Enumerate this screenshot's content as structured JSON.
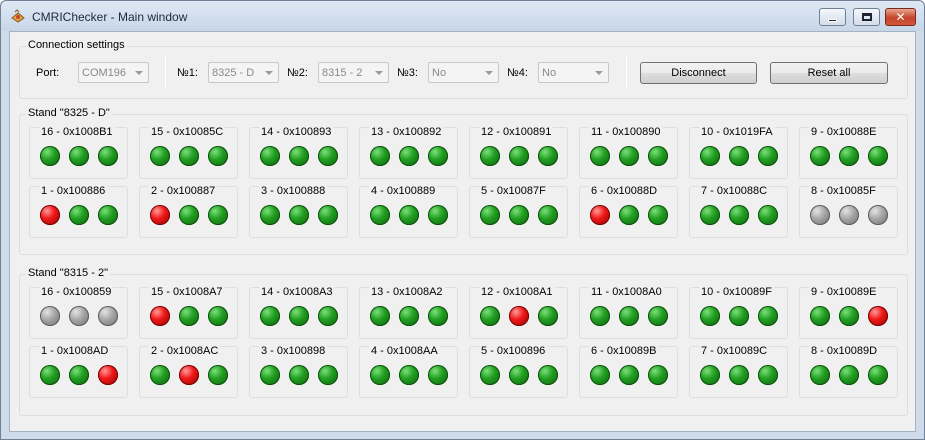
{
  "window": {
    "title": "CMRIChecker - Main window"
  },
  "connection": {
    "group_label": "Connection settings",
    "port_label": "Port:",
    "port_value": "COM196",
    "n1_label": "№1:",
    "n1_value": "8325 - D",
    "n2_label": "№2:",
    "n2_value": "8315 - 2",
    "n3_label": "№3:",
    "n3_value": "No",
    "n4_label": "№4:",
    "n4_value": "No",
    "disconnect_label": "Disconnect",
    "reset_label": "Reset all"
  },
  "stands": [
    {
      "label": "Stand \"8325 - D\"",
      "nodes": [
        {
          "label": "16 - 0x1008B1",
          "leds": [
            "green",
            "green",
            "green"
          ]
        },
        {
          "label": "15 - 0x10085C",
          "leds": [
            "green",
            "green",
            "green"
          ]
        },
        {
          "label": "14 - 0x100893",
          "leds": [
            "green",
            "green",
            "green"
          ]
        },
        {
          "label": "13 - 0x100892",
          "leds": [
            "green",
            "green",
            "green"
          ]
        },
        {
          "label": "12 - 0x100891",
          "leds": [
            "green",
            "green",
            "green"
          ]
        },
        {
          "label": "11 - 0x100890",
          "leds": [
            "green",
            "green",
            "green"
          ]
        },
        {
          "label": "10 - 0x1019FA",
          "leds": [
            "green",
            "green",
            "green"
          ]
        },
        {
          "label": "9 - 0x10088E",
          "leds": [
            "green",
            "green",
            "green"
          ]
        },
        {
          "label": "1 - 0x100886",
          "leds": [
            "red",
            "green",
            "green"
          ]
        },
        {
          "label": "2 - 0x100887",
          "leds": [
            "red",
            "green",
            "green"
          ]
        },
        {
          "label": "3 - 0x100888",
          "leds": [
            "green",
            "green",
            "green"
          ]
        },
        {
          "label": "4 - 0x100889",
          "leds": [
            "green",
            "green",
            "green"
          ]
        },
        {
          "label": "5 - 0x10087F",
          "leds": [
            "green",
            "green",
            "green"
          ]
        },
        {
          "label": "6 - 0x10088D",
          "leds": [
            "red",
            "green",
            "green"
          ]
        },
        {
          "label": "7 - 0x10088C",
          "leds": [
            "green",
            "green",
            "green"
          ]
        },
        {
          "label": "8 - 0x10085F",
          "leds": [
            "gray",
            "gray",
            "gray"
          ]
        }
      ]
    },
    {
      "label": "Stand \"8315 - 2\"",
      "nodes": [
        {
          "label": "16 - 0x100859",
          "leds": [
            "gray",
            "gray",
            "gray"
          ]
        },
        {
          "label": "15 - 0x1008A7",
          "leds": [
            "red",
            "green",
            "green"
          ]
        },
        {
          "label": "14 - 0x1008A3",
          "leds": [
            "green",
            "green",
            "green"
          ]
        },
        {
          "label": "13 - 0x1008A2",
          "leds": [
            "green",
            "green",
            "green"
          ]
        },
        {
          "label": "12 - 0x1008A1",
          "leds": [
            "green",
            "red",
            "green"
          ]
        },
        {
          "label": "11 - 0x1008A0",
          "leds": [
            "green",
            "green",
            "green"
          ]
        },
        {
          "label": "10 - 0x10089F",
          "leds": [
            "green",
            "green",
            "green"
          ]
        },
        {
          "label": "9 - 0x10089E",
          "leds": [
            "green",
            "green",
            "red"
          ]
        },
        {
          "label": "1 - 0x1008AD",
          "leds": [
            "green",
            "green",
            "red"
          ]
        },
        {
          "label": "2 - 0x1008AC",
          "leds": [
            "green",
            "red",
            "green"
          ]
        },
        {
          "label": "3 - 0x100898",
          "leds": [
            "green",
            "green",
            "green"
          ]
        },
        {
          "label": "4 - 0x1008AA",
          "leds": [
            "green",
            "green",
            "green"
          ]
        },
        {
          "label": "5 - 0x100896",
          "leds": [
            "green",
            "green",
            "green"
          ]
        },
        {
          "label": "6 - 0x10089B",
          "leds": [
            "green",
            "green",
            "green"
          ]
        },
        {
          "label": "7 - 0x10089C",
          "leds": [
            "green",
            "green",
            "green"
          ]
        },
        {
          "label": "8 - 0x10089D",
          "leds": [
            "green",
            "green",
            "green"
          ]
        }
      ]
    }
  ]
}
